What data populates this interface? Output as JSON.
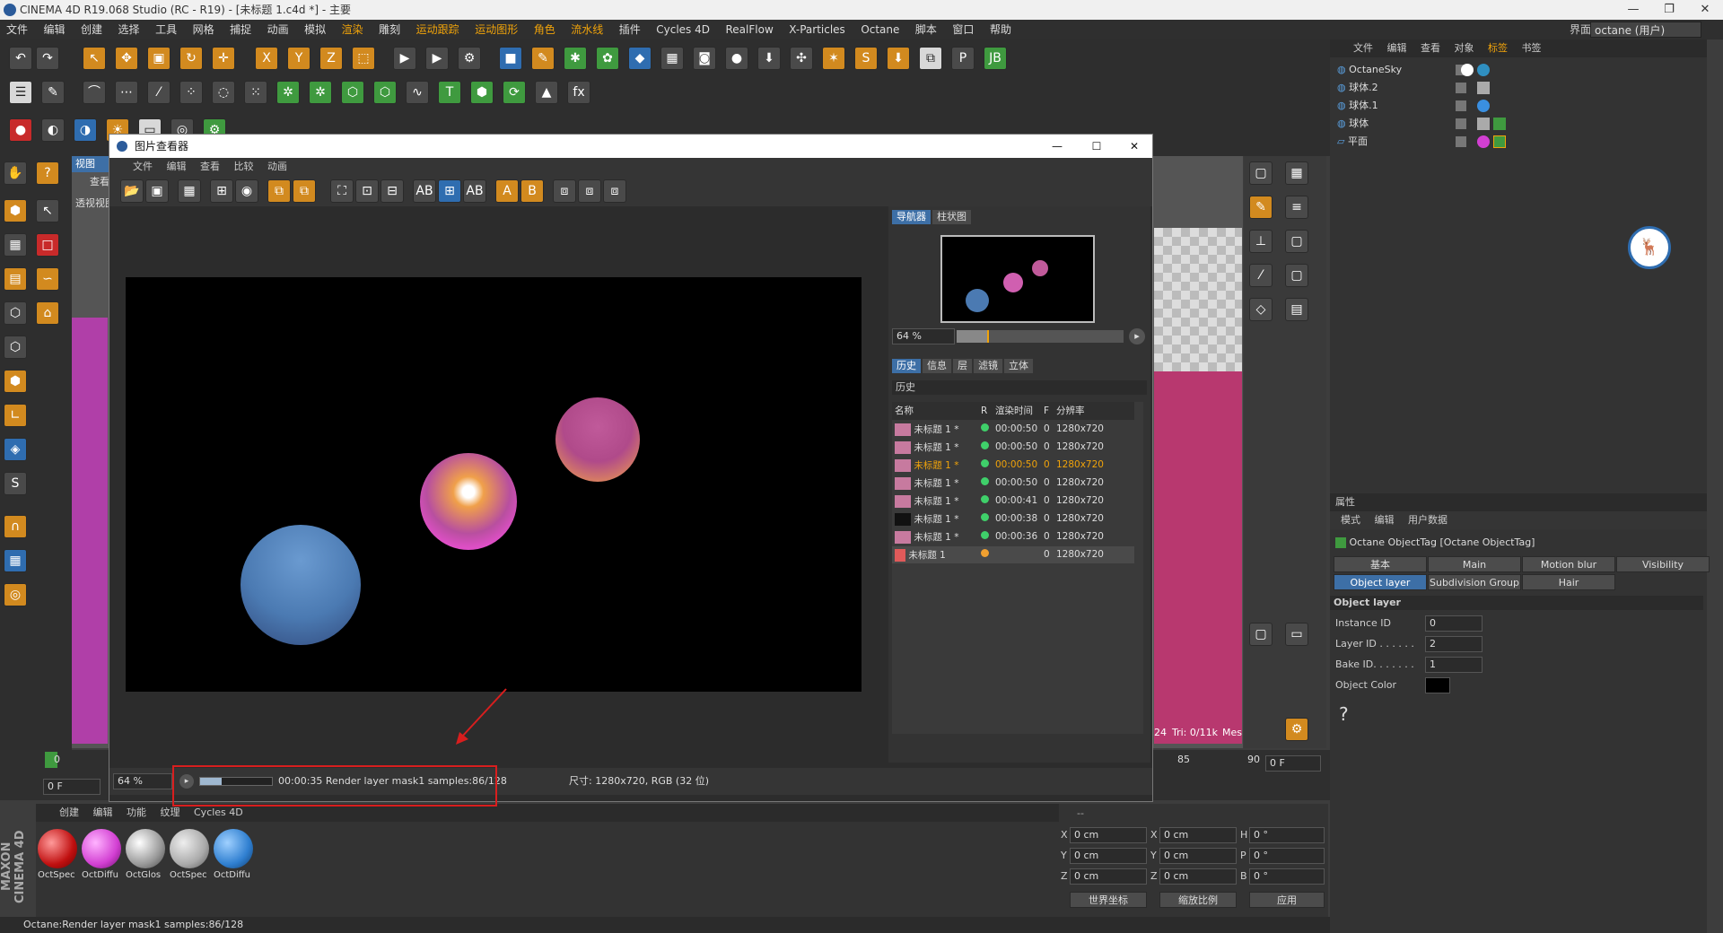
{
  "window": {
    "title": "CINEMA 4D R19.068 Studio (RC - R19) - [未标题 1.c4d *] - 主要"
  },
  "menubar": [
    "文件",
    "编辑",
    "创建",
    "选择",
    "工具",
    "网格",
    "捕捉",
    "动画",
    "模拟",
    "渲染",
    "雕刻",
    "运动跟踪",
    "运动图形",
    "角色",
    "流水线",
    "插件",
    "Cycles 4D",
    "RealFlow",
    "X-Particles",
    "Octane",
    "脚本",
    "窗口",
    "帮助"
  ],
  "layout": {
    "label": "界面:",
    "value": "octane (用户)"
  },
  "viewport": {
    "tab": "视图",
    "sub": "查看",
    "camera": "透视视图",
    "stats": "Tri: 0/11k",
    "stats_prefix": "24",
    "mes": "Mes"
  },
  "picture_viewer": {
    "title": "图片查看器",
    "menu": [
      "文件",
      "编辑",
      "查看",
      "比较",
      "动画"
    ],
    "navigator_tabs": [
      "导航器",
      "柱状图"
    ],
    "zoom": "64 %",
    "history_tabs": [
      "历史",
      "信息",
      "层",
      "滤镜",
      "立体"
    ],
    "history_label": "历史",
    "columns": [
      "名称",
      "R",
      "渲染时间",
      "F",
      "分辨率"
    ],
    "rows": [
      {
        "name": "未标题 1 *",
        "time": "00:00:50",
        "f": "0",
        "res": "1280x720",
        "status": "done",
        "selected": false
      },
      {
        "name": "未标题 1 *",
        "time": "00:00:50",
        "f": "0",
        "res": "1280x720",
        "status": "done",
        "selected": false
      },
      {
        "name": "未标题 1 *",
        "time": "00:00:50",
        "f": "0",
        "res": "1280x720",
        "status": "done",
        "selected": true
      },
      {
        "name": "未标题 1 *",
        "time": "00:00:50",
        "f": "0",
        "res": "1280x720",
        "status": "done",
        "selected": false
      },
      {
        "name": "未标题 1 *",
        "time": "00:00:41",
        "f": "0",
        "res": "1280x720",
        "status": "done",
        "selected": false
      },
      {
        "name": "未标题 1 *",
        "time": "00:00:38",
        "f": "0",
        "res": "1280x720",
        "status": "done",
        "selected": false
      },
      {
        "name": "未标题 1 *",
        "time": "00:00:36",
        "f": "0",
        "res": "1280x720",
        "status": "done",
        "selected": false
      },
      {
        "name": "未标题 1",
        "time": "",
        "f": "0",
        "res": "1280x720",
        "status": "rendering",
        "selected": false
      }
    ],
    "status_zoom": "64 %",
    "progress_text": "00:00:35 Render layer mask1 samples:86/128",
    "progress_fraction": 0.3,
    "size_text": "尺寸: 1280x720, RGB (32 位)"
  },
  "objects": {
    "menu": [
      "文件",
      "编辑",
      "查看",
      "对象",
      "标签",
      "书签"
    ],
    "items": [
      "OctaneSky",
      "球体.2",
      "球体.1",
      "球体",
      "平面"
    ]
  },
  "attributes": {
    "header": "属性",
    "menu": [
      "模式",
      "编辑",
      "用户数据"
    ],
    "title": "Octane ObjectTag [Octane ObjectTag]",
    "tabs_row1": [
      "基本",
      "Main",
      "Motion blur",
      "Visibility"
    ],
    "tabs_row2": [
      "Object layer",
      "Subdivision Group",
      "Hair"
    ],
    "section": "Object layer",
    "fields": [
      {
        "label": "Instance ID",
        "value": "0"
      },
      {
        "label": "Layer ID . . . . . .",
        "value": "2"
      },
      {
        "label": "Bake ID. . . . . . .",
        "value": "1"
      },
      {
        "label": "Object Color",
        "value": ""
      }
    ]
  },
  "timeline": {
    "frame": "0 F",
    "start": "0",
    "m85": "85",
    "m90": "90",
    "end": "0 F"
  },
  "materials": {
    "menu": [
      "创建",
      "编辑",
      "功能",
      "纹理",
      "Cycles 4D"
    ],
    "items": [
      "OctSpec",
      "OctDiffu",
      "OctGlos",
      "OctSpec",
      "OctDiffu"
    ]
  },
  "coords": {
    "header": "--",
    "rows": [
      {
        "a": "X",
        "av": "0 cm",
        "b": "X",
        "bv": "0 cm",
        "c": "H",
        "cv": "0 °"
      },
      {
        "a": "Y",
        "av": "0 cm",
        "b": "Y",
        "bv": "0 cm",
        "c": "P",
        "cv": "0 °"
      },
      {
        "a": "Z",
        "av": "0 cm",
        "b": "Z",
        "bv": "0 cm",
        "c": "B",
        "cv": "0 °"
      }
    ],
    "world": "世界坐标",
    "scale": "缩放比例",
    "apply": "应用"
  },
  "statusbar": "Octane:Render layer mask1 samples:86/128",
  "brand": "MAXON CINEMA 4D",
  "colors": {
    "accent": "#3d6fa6",
    "orange": "#f0a30a",
    "red": "#d81e1e"
  }
}
